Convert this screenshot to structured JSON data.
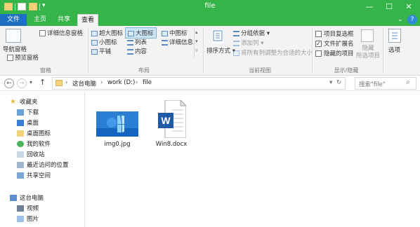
{
  "window": {
    "title": "file"
  },
  "tabs": {
    "file": "文件",
    "home": "主页",
    "share": "共享",
    "view": "查看"
  },
  "ribbon": {
    "pane_group": {
      "nav_pane": "导航窗格",
      "preview_pane": "预览窗格",
      "details_pane": "详细信息窗格",
      "label": "窗格"
    },
    "layout_group": {
      "extra_large_icons": "超大图标",
      "large_icons": "大图标",
      "medium_icons": "中图标",
      "small_icons": "小图标",
      "list": "列表",
      "details": "详细信息",
      "tiles": "平铺",
      "content": "内容",
      "label": "布局"
    },
    "current_view_group": {
      "sort_by": "排序方式",
      "group_by": "分组依据",
      "add_columns": "添加列",
      "size_all_columns": "将所有列调整为合适的大小",
      "label": "当前视图"
    },
    "show_hide_group": {
      "item_checkboxes": "项目复选框",
      "file_name_extensions": "文件扩展名",
      "hidden_items": "隐藏的项目",
      "hide_selected": "隐藏\n所选项目",
      "label": "显示/隐藏"
    },
    "options": "选项"
  },
  "address": {
    "segments": [
      "这台电脑",
      "work (D:)",
      "file"
    ],
    "search_placeholder": "搜索\"file\""
  },
  "nav_pane": {
    "favorites": "收藏夹",
    "favorite_items": [
      "下载",
      "桌面",
      "桌面图标",
      "我的软件",
      "回收站",
      "最近访问的位置",
      "共享空间"
    ],
    "this_pc": "这台电脑",
    "pc_items": [
      "视频",
      "图片"
    ]
  },
  "files": [
    {
      "name": "img0.jpg",
      "type": "image"
    },
    {
      "name": "Win8.docx",
      "type": "word"
    }
  ],
  "colors": {
    "titlebar": "#35b44a",
    "file_tab": "#1d6fc2",
    "ribbon_bg": "#f3f3f3",
    "selected_bg": "#cde6f7",
    "selected_border": "#7fb6e0"
  }
}
